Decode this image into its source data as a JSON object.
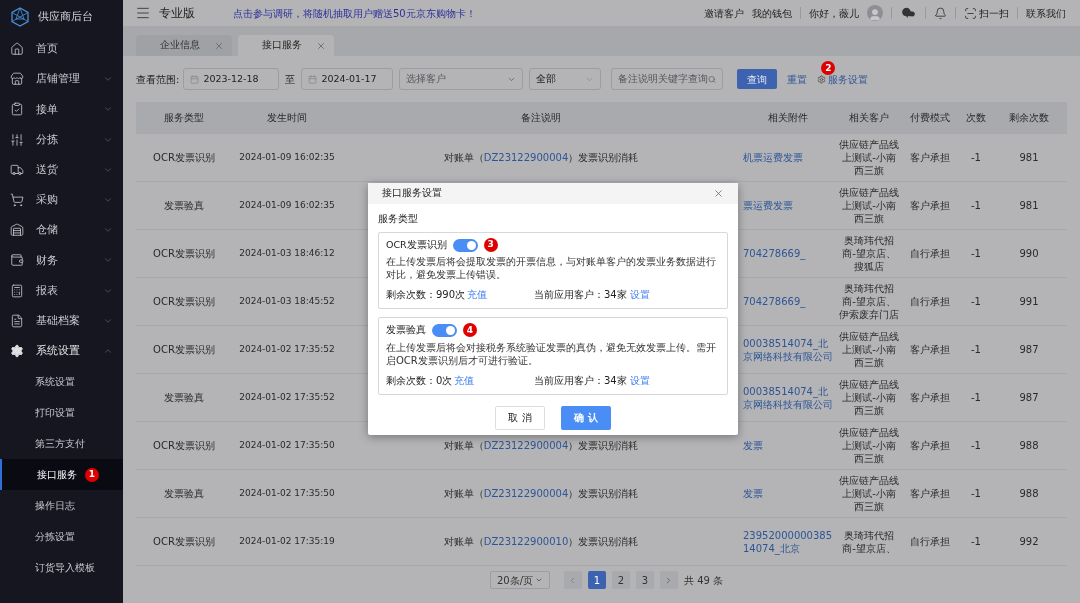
{
  "brand": "供应商后台",
  "sidebar": {
    "items": [
      {
        "label": "首页",
        "expanded": false
      },
      {
        "label": "店铺管理",
        "expanded": false
      },
      {
        "label": "接单",
        "expanded": false
      },
      {
        "label": "分拣",
        "expanded": false
      },
      {
        "label": "送货",
        "expanded": false
      },
      {
        "label": "采购",
        "expanded": false
      },
      {
        "label": "仓储",
        "expanded": false
      },
      {
        "label": "财务",
        "expanded": false
      },
      {
        "label": "报表",
        "expanded": false
      },
      {
        "label": "基础档案",
        "expanded": false
      },
      {
        "label": "系统设置",
        "expanded": true,
        "children": [
          {
            "label": "系统设置",
            "selected": false
          },
          {
            "label": "打印设置",
            "selected": false
          },
          {
            "label": "第三方支付",
            "selected": false
          },
          {
            "label": "接口服务",
            "selected": true,
            "badge": "1"
          },
          {
            "label": "操作日志",
            "selected": false
          },
          {
            "label": "分拣设置",
            "selected": false
          },
          {
            "label": "订货导入模板",
            "selected": false
          }
        ]
      }
    ]
  },
  "topbar": {
    "edition": "专业版",
    "promo": "点击参与调研，将随机抽取用户赠送50元京东购物卡！",
    "links": [
      "邀请客户",
      "我的钱包"
    ],
    "greeting": "你好，薇儿",
    "scan": "扫一扫",
    "contact": "联系我们"
  },
  "tabs": [
    {
      "label": "企业信息",
      "selected": false
    },
    {
      "label": "接口服务",
      "selected": true
    }
  ],
  "filters": {
    "range_label": "查看范围:",
    "start_date": "2023-12-18",
    "to": "至",
    "end_date": "2024-01-17",
    "customer_placeholder": "选择客户",
    "type_value": "全部",
    "search_placeholder": "备注说明关键字查询",
    "query": "查询",
    "reset": "重置",
    "settings": "服务设置",
    "settings_badge": "2"
  },
  "table": {
    "columns": [
      "服务类型",
      "发生时间",
      "备注说明",
      "相关附件",
      "相关客户",
      "付费模式",
      "次数",
      "剩余次数"
    ],
    "rows": [
      {
        "type": "OCR发票识别",
        "time": "2024-01-09 16:02:35",
        "note_prefix": "对账单（",
        "note_link": "DZ23122900004",
        "note_suffix": "）发票识别消耗",
        "attachment": "机票运费发票",
        "customer": "供应链产品线上测试-小南西三旗",
        "pay": "客户承担",
        "count": "-1",
        "remain": "981"
      },
      {
        "type": "发票验真",
        "time": "2024-01-09 16:02:35",
        "attachment": "票运费发票",
        "customer": "供应链产品线上测试-小南西三旗",
        "pay": "客户承担",
        "count": "-1",
        "remain": "981"
      },
      {
        "type": "OCR发票识别",
        "time": "2024-01-03 18:46:12",
        "attachment": "704278669_",
        "customer": "奥琦玮代招商-望京店、搜狐店",
        "pay": "自行承担",
        "count": "-1",
        "remain": "990"
      },
      {
        "type": "OCR发票识别",
        "time": "2024-01-03 18:45:52",
        "attachment": "704278669_",
        "customer": "奥琦玮代招商-望京店、伊索废弃门店",
        "pay": "自行承担",
        "count": "-1",
        "remain": "991"
      },
      {
        "type": "OCR发票识别",
        "time": "2024-01-02 17:35:52",
        "attachment": "00038514074_北京网络科技有限公司",
        "customer": "供应链产品线上测试-小南西三旗",
        "pay": "客户承担",
        "count": "-1",
        "remain": "987"
      },
      {
        "type": "发票验真",
        "time": "2024-01-02 17:35:52",
        "attachment": "00038514074_北京网络科技有限公司",
        "customer": "供应链产品线上测试-小南西三旗",
        "pay": "客户承担",
        "count": "-1",
        "remain": "987"
      },
      {
        "type": "OCR发票识别",
        "time": "2024-01-02 17:35:50",
        "note_prefix": "对账单（",
        "note_link": "DZ23122900004",
        "note_suffix": "）发票识别消耗",
        "attachment": "发票",
        "customer": "供应链产品线上测试-小南西三旗",
        "pay": "客户承担",
        "count": "-1",
        "remain": "988"
      },
      {
        "type": "发票验真",
        "time": "2024-01-02 17:35:50",
        "note_prefix": "对账单（",
        "note_link": "DZ23122900004",
        "note_suffix": "）发票识别消耗",
        "attachment": "发票",
        "customer": "供应链产品线上测试-小南西三旗",
        "pay": "客户承担",
        "count": "-1",
        "remain": "988"
      },
      {
        "type": "OCR发票识别",
        "time": "2024-01-02 17:35:19",
        "note_prefix": "对账单（",
        "note_link": "DZ23122900010",
        "note_suffix": "）发票识别消耗",
        "attachment": "2395200000038514074_北京",
        "customer": "奥琦玮代招商-望京店、",
        "pay": "自行承担",
        "count": "-1",
        "remain": "992"
      }
    ]
  },
  "pagination": {
    "page_size": "20条/页",
    "pages": [
      {
        "label": "1",
        "selected": true
      },
      {
        "label": "2",
        "selected": false
      },
      {
        "label": "3",
        "selected": false
      }
    ],
    "total": "共 49 条"
  },
  "dialog": {
    "title": "接口服务设置",
    "section": "服务类型",
    "services": [
      {
        "name": "OCR发票识别",
        "on": true,
        "badge": "3",
        "description": "在上传发票后将会提取发票的开票信息，与对账单客户的发票业务数据进行对比，避免发票上传错误。",
        "remaining": "剩余次数：990次",
        "recharge": "充值",
        "customers": "当前应用客户：34家",
        "setup": "设置"
      },
      {
        "name": "发票验真",
        "on": true,
        "badge": "4",
        "description": "在上传发票后将会对接税务系统验证发票的真伪，避免无效发票上传。需开启OCR发票识别后才可进行验证。",
        "remaining": "剩余次数：0次",
        "recharge": "充值",
        "customers": "当前应用客户：34家",
        "setup": "设置"
      }
    ],
    "cancel": "取 消",
    "confirm": "确 认"
  }
}
